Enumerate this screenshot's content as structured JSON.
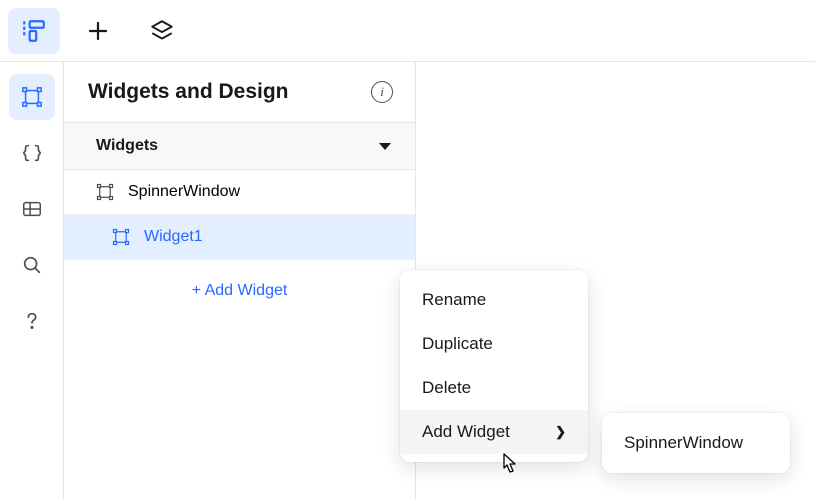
{
  "panel": {
    "title": "Widgets and Design",
    "section_title": "Widgets",
    "info_glyph": "i",
    "tree": [
      {
        "label": "SpinnerWindow",
        "selected": false
      },
      {
        "label": "Widget1",
        "selected": true
      }
    ],
    "add_widget_label": "+ Add Widget"
  },
  "context_menu": {
    "items": [
      {
        "label": "Rename",
        "has_submenu": false
      },
      {
        "label": "Duplicate",
        "has_submenu": false
      },
      {
        "label": "Delete",
        "has_submenu": false
      },
      {
        "label": "Add Widget",
        "has_submenu": true,
        "hover": true
      }
    ]
  },
  "submenu": {
    "items": [
      {
        "label": "SpinnerWindow"
      }
    ]
  },
  "colors": {
    "accent": "#2869ff",
    "accent_bg": "#e3eeff"
  }
}
